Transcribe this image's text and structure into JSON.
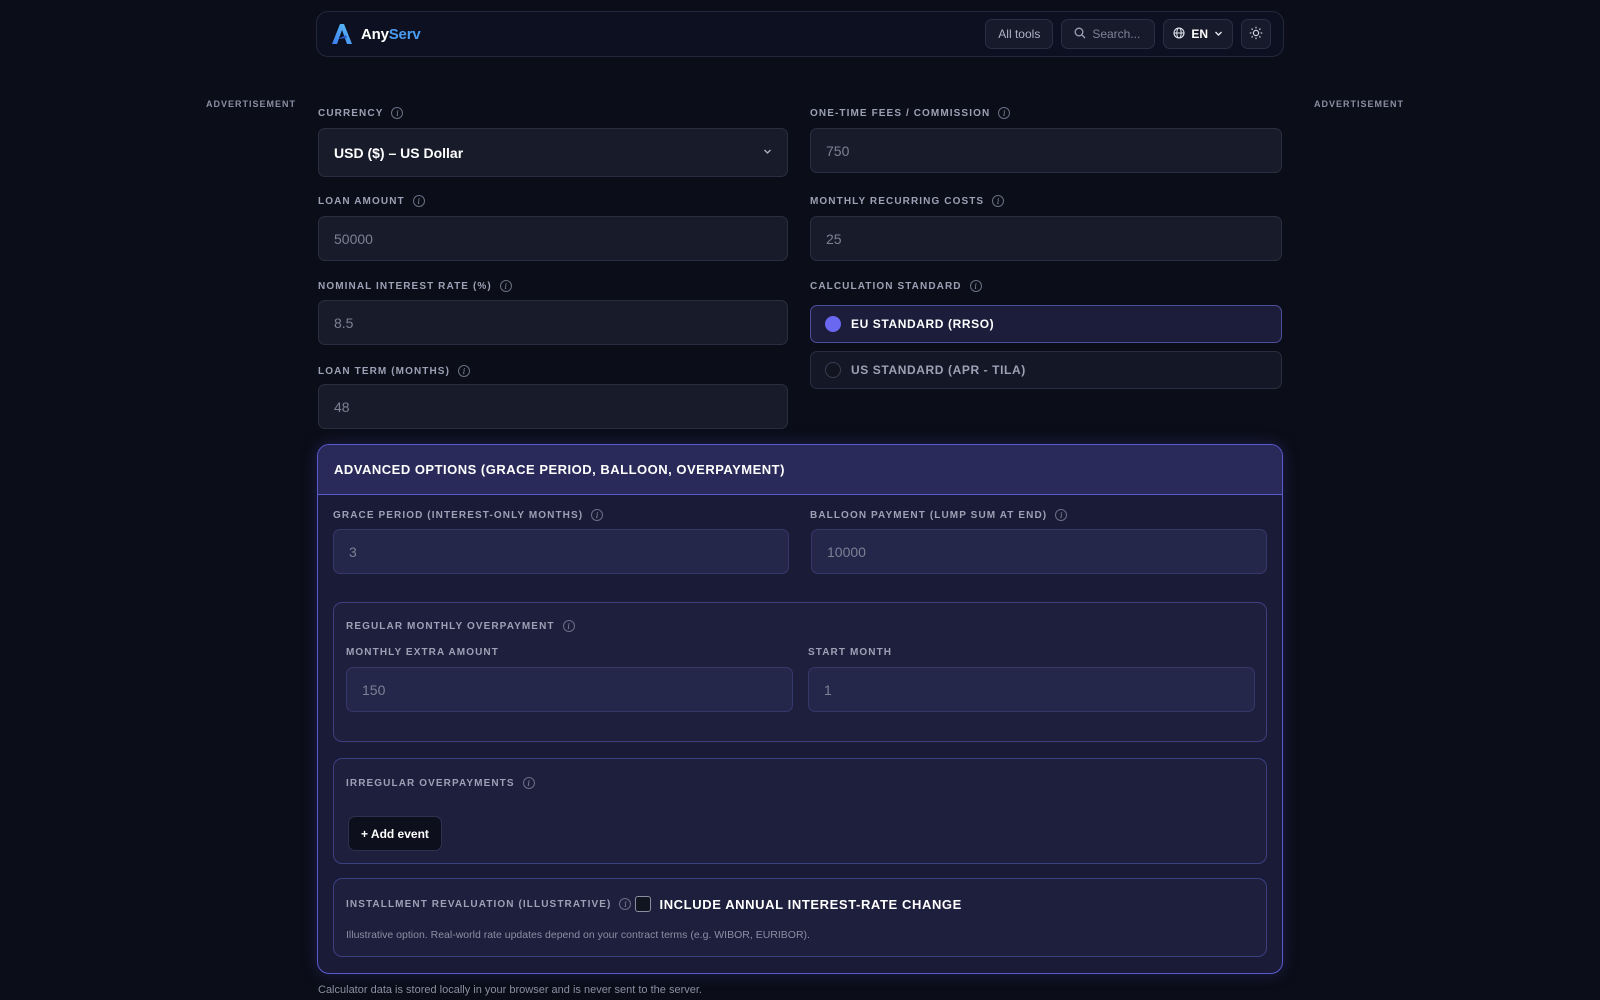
{
  "header": {
    "brand_any": "Any",
    "brand_serv": "Serv",
    "all_tools": "All tools",
    "search_placeholder": "Search...",
    "language": "EN"
  },
  "ads": {
    "left": "ADVERTISEMENT",
    "right": "ADVERTISEMENT"
  },
  "form": {
    "currency": {
      "label": "CURRENCY",
      "value": "USD ($) – US Dollar"
    },
    "loan_amount": {
      "label": "LOAN AMOUNT",
      "value": "50000"
    },
    "interest_rate": {
      "label": "NOMINAL INTEREST RATE (%)",
      "value": "8.5"
    },
    "loan_term": {
      "label": "LOAN TERM (MONTHS)",
      "value": "48"
    },
    "fees": {
      "label": "ONE-TIME FEES / COMMISSION",
      "value": "750"
    },
    "recurring": {
      "label": "MONTHLY RECURRING COSTS",
      "value": "25"
    },
    "standard": {
      "label": "CALCULATION STANDARD",
      "options": [
        {
          "label": "EU STANDARD (RRSO)",
          "selected": true
        },
        {
          "label": "US STANDARD (APR - TILA)",
          "selected": false
        }
      ]
    }
  },
  "advanced": {
    "title": "ADVANCED OPTIONS (GRACE PERIOD, BALLOON, OVERPAYMENT)",
    "grace": {
      "label": "GRACE PERIOD (INTEREST-ONLY MONTHS)",
      "value": "3"
    },
    "balloon": {
      "label": "BALLOON PAYMENT (LUMP SUM AT END)",
      "value": "10000"
    },
    "regular": {
      "title": "REGULAR MONTHLY OVERPAYMENT",
      "extra_label": "MONTHLY EXTRA AMOUNT",
      "extra_value": "150",
      "start_label": "START MONTH",
      "start_value": "1"
    },
    "irregular": {
      "title": "IRREGULAR OVERPAYMENTS",
      "add_button": "+ Add event"
    },
    "revaluation": {
      "title": "INSTALLMENT REVALUATION (ILLUSTRATIVE)",
      "checkbox_label": "INCLUDE ANNUAL INTEREST-RATE CHANGE",
      "note": "Illustrative option. Real-world rate updates depend on your contract terms (e.g. WIBOR, EURIBOR)."
    }
  },
  "footer_note": "Calculator data is stored locally in your browser and is never sent to the server.",
  "colors": {
    "accent": "#6a67f0",
    "brand_blue": "#4a9cf0",
    "background": "#0b0d18"
  },
  "icons": [
    "logo-icon",
    "search-icon",
    "globe-icon",
    "chevron-down-icon",
    "sun-icon",
    "info-icon"
  ]
}
